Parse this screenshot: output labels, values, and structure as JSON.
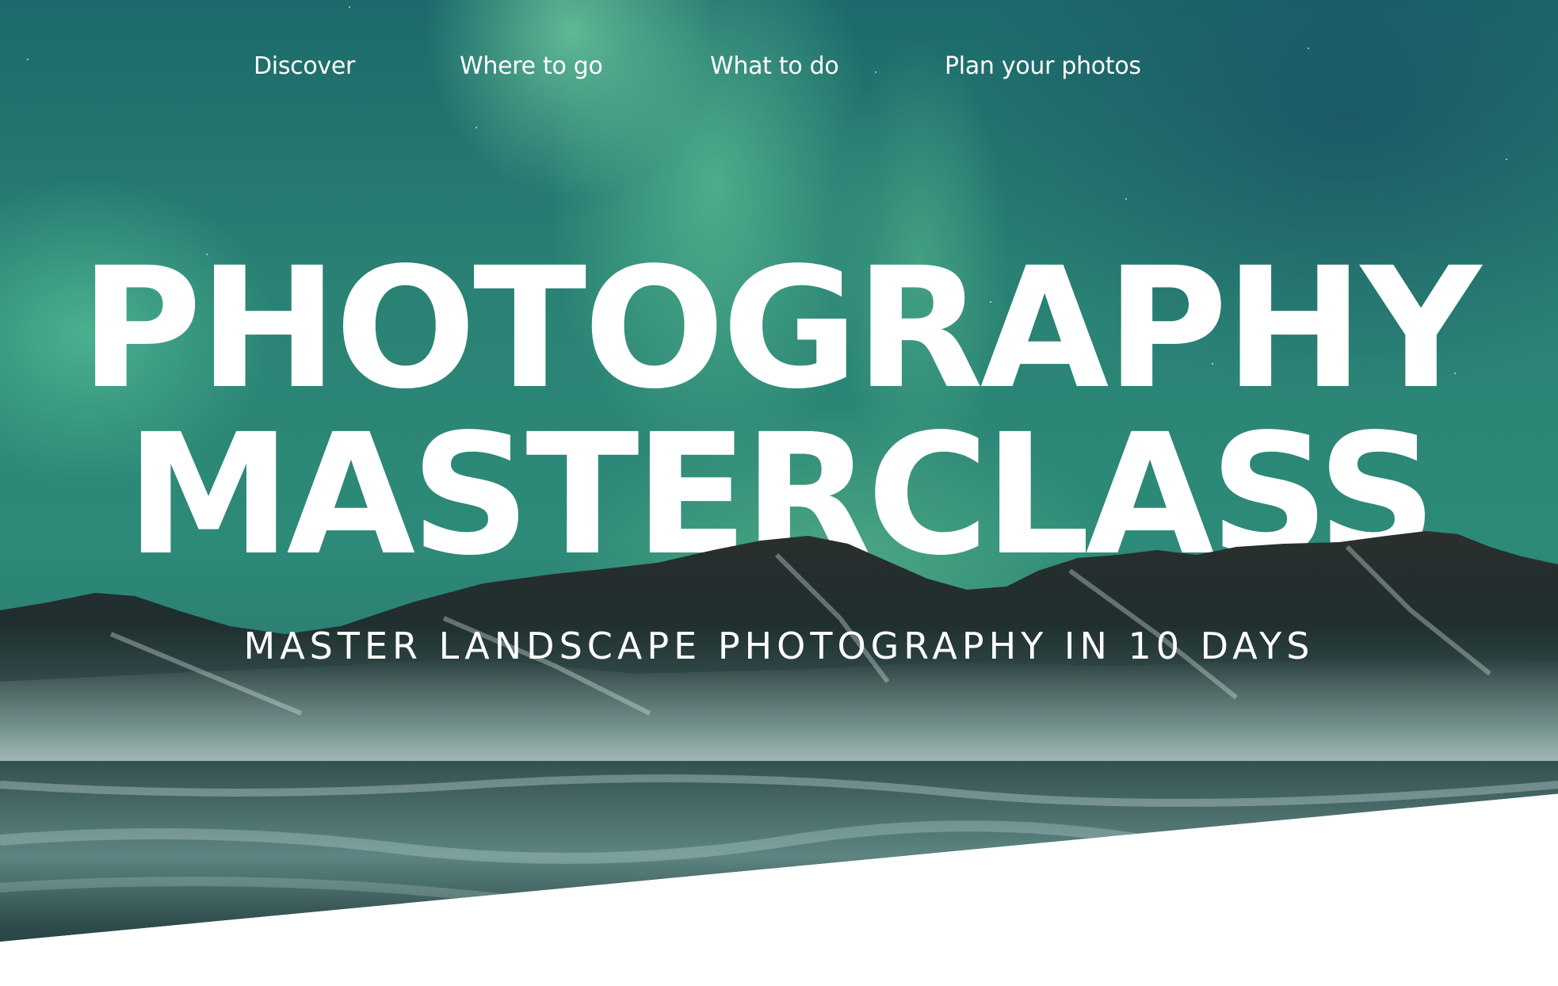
{
  "nav": {
    "items": [
      {
        "label": "Discover"
      },
      {
        "label": "Where to go"
      },
      {
        "label": "What to do"
      },
      {
        "label": "Plan your photos"
      }
    ]
  },
  "hero": {
    "title_line_1": "PHOTOGRAPHY",
    "title_line_2": "MASTERCLASS",
    "subtitle": "MASTER LANDSCAPE PHOTOGRAPHY IN 10 DAYS",
    "background": "aurora-mountains-image"
  },
  "colors": {
    "sky_teal": "#2a8274",
    "aurora_green": "#6ed7a0",
    "mountain_dark": "#1e2b2c",
    "text": "#ffffff",
    "page_background": "#ffffff"
  }
}
